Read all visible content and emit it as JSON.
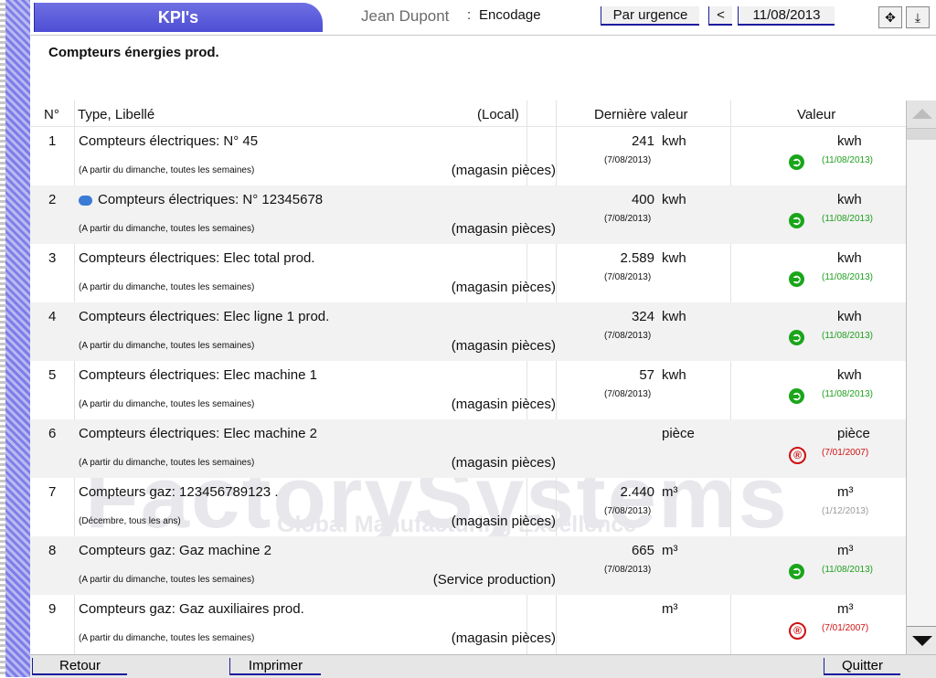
{
  "header": {
    "tab_title": "KPI's",
    "user": "Jean Dupont",
    "separator": ":",
    "mode": "Encodage",
    "urgence_label": "Par urgence",
    "prev_label": "<",
    "date": "11/08/2013"
  },
  "subtitle": "Compteurs énergies prod.",
  "watermark": {
    "brand": "FactorySystems",
    "tagline": "Global Manufacturing Excellence"
  },
  "columns": {
    "num": "N°",
    "type": "Type, Libellé",
    "local": "(Local)",
    "last_value": "Dernière valeur",
    "value": "Valeur"
  },
  "rows": [
    {
      "num": "1",
      "label": "Compteurs électriques: N° 45",
      "info": false,
      "schedule": "(A partir du dimanche, toutes les semaines)",
      "location": "(magasin pièces)",
      "last_value": "241",
      "last_unit": "kwh",
      "last_date": "(7/08/2013)",
      "unit": "kwh",
      "status": "ok",
      "status_date": "(11/08/2013)"
    },
    {
      "num": "2",
      "label": "Compteurs électriques: N° 12345678",
      "info": true,
      "schedule": "(A partir du dimanche, toutes les semaines)",
      "location": "(magasin pièces)",
      "last_value": "400",
      "last_unit": "kwh",
      "last_date": "(7/08/2013)",
      "unit": "kwh",
      "status": "ok",
      "status_date": "(11/08/2013)"
    },
    {
      "num": "3",
      "label": "Compteurs électriques: Elec total prod.",
      "info": false,
      "schedule": "(A partir du dimanche, toutes les semaines)",
      "location": "(magasin pièces)",
      "last_value": "2.589",
      "last_unit": "kwh",
      "last_date": "(7/08/2013)",
      "unit": "kwh",
      "status": "ok",
      "status_date": "(11/08/2013)"
    },
    {
      "num": "4",
      "label": "Compteurs électriques: Elec ligne 1 prod.",
      "info": false,
      "schedule": "(A partir du dimanche, toutes les semaines)",
      "location": "(magasin pièces)",
      "last_value": "324",
      "last_unit": "kwh",
      "last_date": "(7/08/2013)",
      "unit": "kwh",
      "status": "ok",
      "status_date": "(11/08/2013)"
    },
    {
      "num": "5",
      "label": "Compteurs électriques: Elec machine 1",
      "info": false,
      "schedule": "(A partir du dimanche, toutes les semaines)",
      "location": "(magasin pièces)",
      "last_value": "57",
      "last_unit": "kwh",
      "last_date": "(7/08/2013)",
      "unit": "kwh",
      "status": "ok",
      "status_date": "(11/08/2013)"
    },
    {
      "num": "6",
      "label": "Compteurs électriques: Elec machine 2",
      "info": false,
      "schedule": "(A partir du dimanche, toutes les semaines)",
      "location": "(magasin pièces)",
      "last_value": "",
      "last_unit": "pièce",
      "last_date": "",
      "unit": "pièce",
      "status": "late",
      "status_date": "(7/01/2007)"
    },
    {
      "num": "7",
      "label": "Compteurs gaz: 123456789123 .",
      "info": false,
      "schedule": "(Décembre, tous les ans)",
      "location": "(magasin pièces)",
      "last_value": "2.440",
      "last_unit": "m³",
      "last_date": "(7/08/2013)",
      "unit": "m³",
      "status": "none",
      "status_date": "(1/12/2013)"
    },
    {
      "num": "8",
      "label": "Compteurs gaz: Gaz machine 2",
      "info": false,
      "schedule": "(A partir du dimanche, toutes les semaines)",
      "location": "(Service production)",
      "last_value": "665",
      "last_unit": "m³",
      "last_date": "(7/08/2013)",
      "unit": "m³",
      "status": "ok",
      "status_date": "(11/08/2013)"
    },
    {
      "num": "9",
      "label": "Compteurs gaz: Gaz auxiliaires prod.",
      "info": false,
      "schedule": "(A partir du dimanche, toutes les semaines)",
      "location": "(magasin pièces)",
      "last_value": "",
      "last_unit": "m³",
      "last_date": "",
      "unit": "m³",
      "status": "late",
      "status_date": "(7/01/2007)"
    }
  ],
  "footer": {
    "back_label": "Retour",
    "print_label": "Imprimer",
    "quit_label": "Quitter"
  },
  "colors": {
    "accent": "#5a5bdc",
    "ok": "#1aa51a",
    "late": "#d01010"
  }
}
